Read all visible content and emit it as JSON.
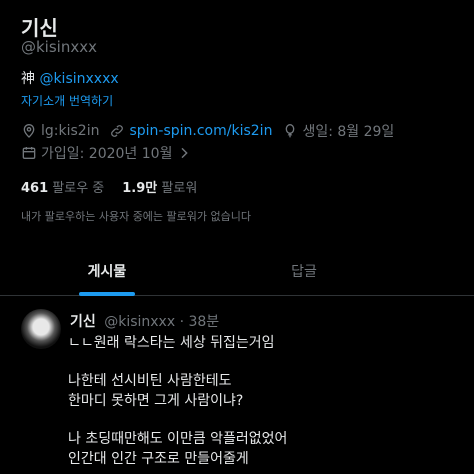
{
  "profile": {
    "name": "기신",
    "handle": "@kisinxxx",
    "bio_prefix": "神",
    "bio_mention": "@kisinxxxx",
    "translate_label": "자기소개 번역하기",
    "location": "lg:kis2in",
    "website": "spin-spin.com/kis2in",
    "birthday": "생일: 8월 29일",
    "joined": "가입일: 2020년 10월",
    "following_count": "461",
    "following_label": "팔로우 중",
    "followers_count": "1.9만",
    "followers_label": "팔로워",
    "not_followed_notice": "내가 팔로우하는 사용자 중에는 팔로워가 없습니다"
  },
  "tabs": [
    {
      "label": "게시물"
    },
    {
      "label": "답글"
    }
  ],
  "post": {
    "name": "기신",
    "handle_time": "@kisinxxx · 38분",
    "lines": [
      "ㄴㄴ원래 락스타는 세상 뒤집는거임",
      "",
      "나한테 선시비틴 사람한테도",
      "한마디 못하면 그게 사람이냐?",
      "",
      "나 초딩때만해도 이만큼 악플러없었어",
      "인간대 인간 구조로 만들어줄게"
    ]
  },
  "colors": {
    "background": "#000000",
    "text": "#e7e9ea",
    "muted": "#71767b",
    "accent": "#1d9bf0",
    "divider": "#2f3336"
  },
  "icons": [
    "location-pin-icon",
    "link-icon",
    "balloon-icon",
    "calendar-icon",
    "chevron-right-icon"
  ]
}
